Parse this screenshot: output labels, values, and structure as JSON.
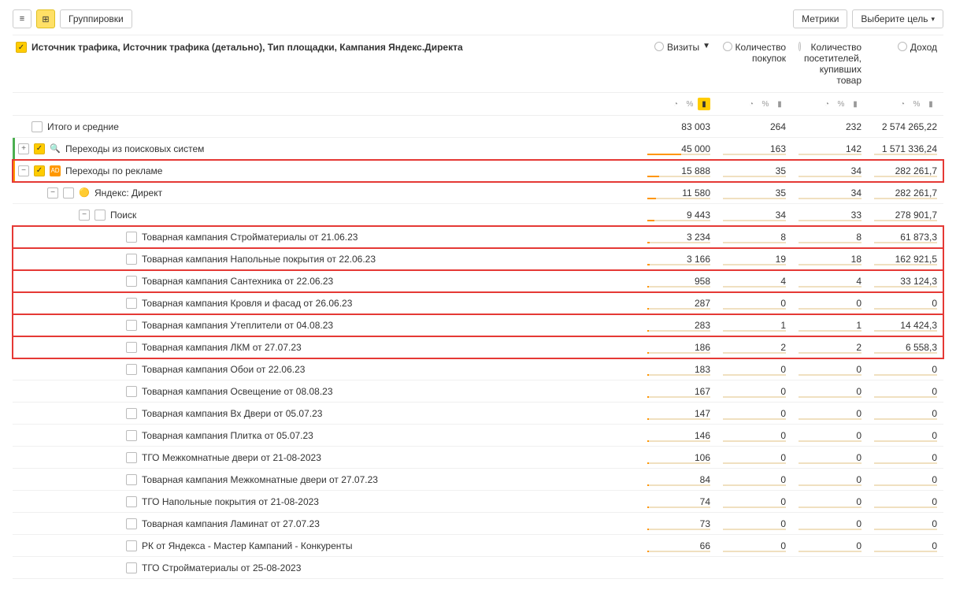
{
  "toolbar": {
    "groupings_label": "Группировки",
    "metrics_label": "Метрики",
    "goal_label": "Выберите цель"
  },
  "dimensions_header": "Источник трафика, Источник трафика (детально), Тип площадки, Кампания Яндекс.Директа",
  "metrics": [
    {
      "label": "Визиты",
      "sorted": true,
      "selected_icon": true
    },
    {
      "label": "Количество\nпокупок",
      "sorted": false,
      "selected_icon": false
    },
    {
      "label": "Количество\nпосетителей,\nкупивших\nтовар",
      "sorted": false,
      "selected_icon": false
    },
    {
      "label": "Доход",
      "sorted": false,
      "selected_icon": false
    }
  ],
  "totals_label": "Итого и средние",
  "totals": [
    "83 003",
    "264",
    "232",
    "2 574 265,22"
  ],
  "rows": [
    {
      "indent": 0,
      "expander": "+",
      "checked": true,
      "icon": "search",
      "icon_color": "#d32f2f",
      "label": "Переходы из поисковых систем",
      "values": [
        "45 000",
        "163",
        "142",
        "1 571 336,24"
      ],
      "accent": "green"
    },
    {
      "indent": 0,
      "expander": "-",
      "checked": true,
      "icon": "ad",
      "icon_color": "#ff9800",
      "label": "Переходы по рекламе",
      "values": [
        "15 888",
        "35",
        "34",
        "282 261,7"
      ],
      "highlight": true,
      "accent": "orange"
    },
    {
      "indent": 1,
      "expander": "-",
      "checked": false,
      "icon": "yandex",
      "label": "Яндекс: Директ",
      "values": [
        "11 580",
        "35",
        "34",
        "282 261,7"
      ]
    },
    {
      "indent": 2,
      "expander": "-",
      "checked": false,
      "label": "Поиск",
      "values": [
        "9 443",
        "34",
        "33",
        "278 901,7"
      ]
    },
    {
      "indent": 3,
      "checked": false,
      "label": "Товарная кампания Стройматериалы от 21.06.23",
      "values": [
        "3 234",
        "8",
        "8",
        "61 873,3"
      ],
      "highlight": true
    },
    {
      "indent": 3,
      "checked": false,
      "label": "Товарная кампания Напольные покрытия от 22.06.23",
      "values": [
        "3 166",
        "19",
        "18",
        "162 921,5"
      ],
      "highlight": true
    },
    {
      "indent": 3,
      "checked": false,
      "label": "Товарная кампания Сантехника от 22.06.23",
      "values": [
        "958",
        "4",
        "4",
        "33 124,3"
      ],
      "highlight": true
    },
    {
      "indent": 3,
      "checked": false,
      "label": "Товарная кампания Кровля и фасад от 26.06.23",
      "values": [
        "287",
        "0",
        "0",
        "0"
      ],
      "highlight": true
    },
    {
      "indent": 3,
      "checked": false,
      "label": "Товарная кампания Утеплители от 04.08.23",
      "values": [
        "283",
        "1",
        "1",
        "14 424,3"
      ],
      "highlight": true
    },
    {
      "indent": 3,
      "checked": false,
      "label": "Товарная кампания ЛКМ от 27.07.23",
      "values": [
        "186",
        "2",
        "2",
        "6 558,3"
      ],
      "highlight": true
    },
    {
      "indent": 3,
      "checked": false,
      "label": "Товарная кампания Обои от 22.06.23",
      "values": [
        "183",
        "0",
        "0",
        "0"
      ]
    },
    {
      "indent": 3,
      "checked": false,
      "label": "Товарная кампания Освещение от 08.08.23",
      "values": [
        "167",
        "0",
        "0",
        "0"
      ]
    },
    {
      "indent": 3,
      "checked": false,
      "label": "Товарная кампания Вх Двери от 05.07.23",
      "values": [
        "147",
        "0",
        "0",
        "0"
      ]
    },
    {
      "indent": 3,
      "checked": false,
      "label": "Товарная кампания Плитка от 05.07.23",
      "values": [
        "146",
        "0",
        "0",
        "0"
      ]
    },
    {
      "indent": 3,
      "checked": false,
      "label": "ТГО Межкомнатные двери от 21-08-2023",
      "values": [
        "106",
        "0",
        "0",
        "0"
      ]
    },
    {
      "indent": 3,
      "checked": false,
      "label": "Товарная кампания Межкомнатные двери от 27.07.23",
      "values": [
        "84",
        "0",
        "0",
        "0"
      ]
    },
    {
      "indent": 3,
      "checked": false,
      "label": "ТГО Напольные покрытия от 21-08-2023",
      "values": [
        "74",
        "0",
        "0",
        "0"
      ]
    },
    {
      "indent": 3,
      "checked": false,
      "label": "Товарная кампания Ламинат от 27.07.23",
      "values": [
        "73",
        "0",
        "0",
        "0"
      ]
    },
    {
      "indent": 3,
      "checked": false,
      "label": "РК от Яндекса - Мастер Кампаний - Конкуренты",
      "values": [
        "66",
        "0",
        "0",
        "0"
      ]
    },
    {
      "indent": 3,
      "checked": false,
      "label": "ТГО Стройматериалы от 25-08-2023",
      "values": [
        "",
        "",
        "",
        ""
      ]
    }
  ],
  "max_visits": 83003
}
